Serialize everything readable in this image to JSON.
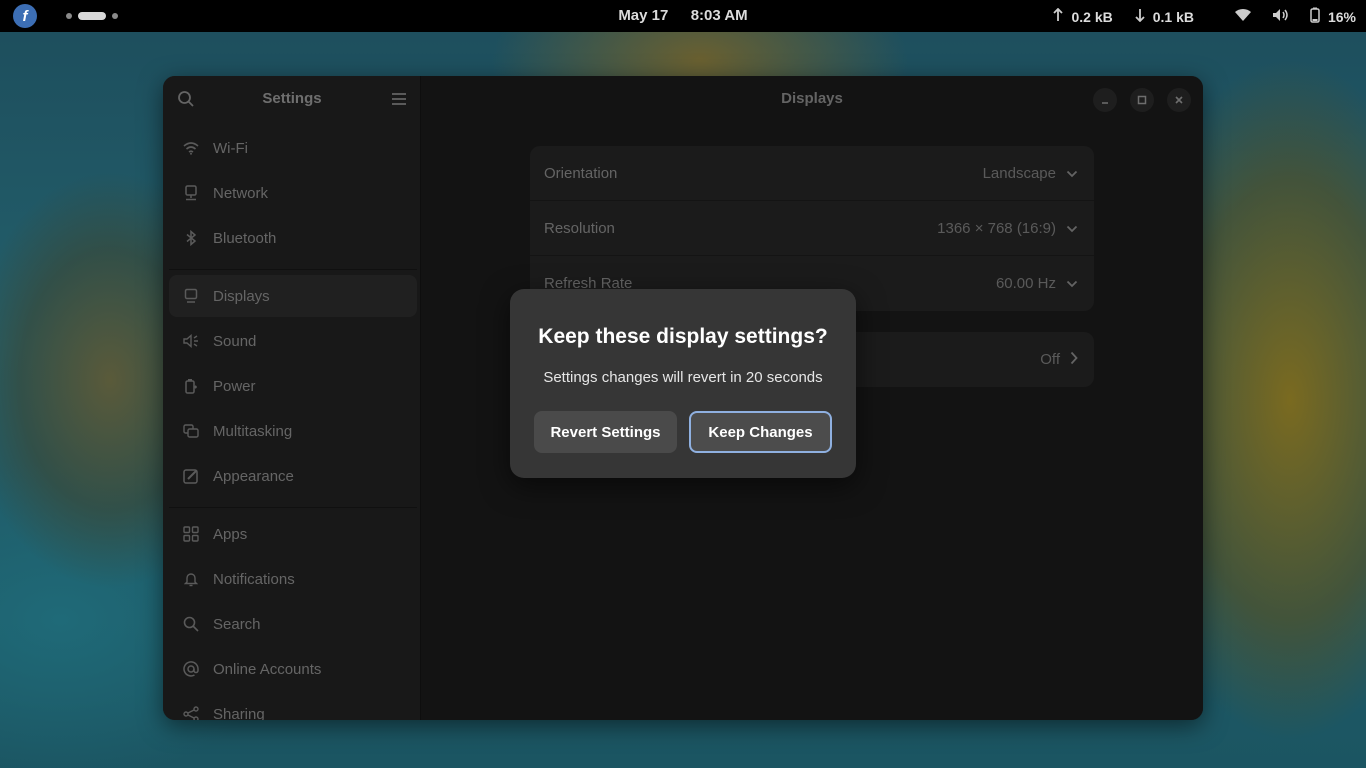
{
  "topbar": {
    "date": "May 17",
    "time": "8:03 AM",
    "upload": "0.2 kB",
    "download": "0.1 kB",
    "battery": "16%"
  },
  "sidebar": {
    "title": "Settings",
    "items": [
      {
        "label": "Wi-Fi",
        "icon": "wifi-icon"
      },
      {
        "label": "Network",
        "icon": "network-icon"
      },
      {
        "label": "Bluetooth",
        "icon": "bluetooth-icon"
      },
      {
        "label": "Displays",
        "icon": "display-icon"
      },
      {
        "label": "Sound",
        "icon": "speaker-icon"
      },
      {
        "label": "Power",
        "icon": "power-icon"
      },
      {
        "label": "Multitasking",
        "icon": "multitasking-icon"
      },
      {
        "label": "Appearance",
        "icon": "appearance-icon"
      },
      {
        "label": "Apps",
        "icon": "apps-grid-icon"
      },
      {
        "label": "Notifications",
        "icon": "bell-icon"
      },
      {
        "label": "Search",
        "icon": "search-icon"
      },
      {
        "label": "Online Accounts",
        "icon": "at-icon"
      },
      {
        "label": "Sharing",
        "icon": "share-icon"
      }
    ]
  },
  "content": {
    "title": "Displays",
    "settings": [
      {
        "label": "Orientation",
        "value": "Landscape"
      },
      {
        "label": "Resolution",
        "value": "1366 × 768 (16:9)"
      },
      {
        "label": "Refresh Rate",
        "value": "60.00 Hz"
      }
    ],
    "night_light_value": "Off"
  },
  "dialog": {
    "title": "Keep these display settings?",
    "body": "Settings changes will revert in 20 seconds",
    "revert_label": "Revert Settings",
    "keep_label": "Keep Changes"
  }
}
